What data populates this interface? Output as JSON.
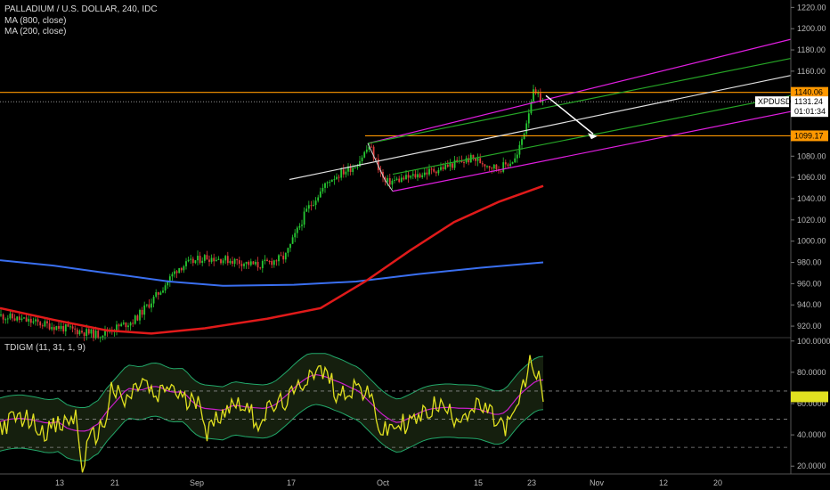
{
  "header": {
    "title": "PALLADIUM / U.S. DOLLAR, 240, IDC",
    "ma1": "MA (800, close)",
    "ma2": "MA (200, close)"
  },
  "indicator": {
    "label": "TDIGM (11, 31, 1, 9)"
  },
  "price_tags": {
    "upper_level": "1140.06",
    "current": "1131.24",
    "symbol": "XPDUSD",
    "countdown": "01:01:34",
    "lower_level": "1099.17"
  },
  "colors": {
    "background": "#000000",
    "candle_up": "#26c832",
    "candle_down": "#e03b3b",
    "ma800": "#3a6ff0",
    "ma200": "#e01a1a",
    "level_line": "#ff9800",
    "channel_outer": "#e01ee0",
    "channel_inner": "#26a626",
    "median_line": "#e0e0e0",
    "rsi": "#e0e020",
    "rsi_signal": "#c81ec8",
    "band": "#22a86a"
  },
  "chart_data": [
    {
      "type": "line",
      "title": "PALLADIUM / U.S. DOLLAR, 240, IDC",
      "x_ticks": [
        "13",
        "21",
        "Sep",
        "17",
        "Oct",
        "15",
        "23",
        "Nov",
        "12",
        "20"
      ],
      "y_ticks": [
        920,
        940,
        960,
        980,
        1000,
        1020,
        1040,
        1060,
        1080,
        1100,
        1120,
        1140,
        1160,
        1180,
        1200,
        1220
      ],
      "ylim": [
        910,
        1227
      ],
      "grid": false,
      "series": [
        {
          "name": "MA (800, close)",
          "points": [
            [
              0,
              982
            ],
            [
              60,
              977
            ],
            [
              120,
              970
            ],
            [
              190,
              962
            ],
            [
              250,
              958
            ],
            [
              330,
              959
            ],
            [
              400,
              962
            ],
            [
              470,
              969
            ],
            [
              540,
              975
            ],
            [
              610,
              980
            ]
          ]
        },
        {
          "name": "MA (200, close)",
          "points": [
            [
              0,
              937
            ],
            [
              60,
              926
            ],
            [
              120,
              916
            ],
            [
              170,
              913
            ],
            [
              230,
              918
            ],
            [
              300,
              927
            ],
            [
              360,
              937
            ],
            [
              410,
              962
            ],
            [
              460,
              991
            ],
            [
              510,
              1018
            ],
            [
              560,
              1037
            ],
            [
              610,
              1052
            ]
          ]
        }
      ],
      "price_path": [
        [
          0,
          930
        ],
        [
          60,
          920
        ],
        [
          110,
          912
        ],
        [
          150,
          925
        ],
        [
          175,
          948
        ],
        [
          200,
          975
        ],
        [
          230,
          985
        ],
        [
          260,
          982
        ],
        [
          290,
          977
        ],
        [
          320,
          985
        ],
        [
          345,
          1030
        ],
        [
          370,
          1058
        ],
        [
          400,
          1072
        ],
        [
          415,
          1090
        ],
        [
          432,
          1055
        ],
        [
          460,
          1060
        ],
        [
          500,
          1070
        ],
        [
          530,
          1078
        ],
        [
          560,
          1068
        ],
        [
          580,
          1078
        ],
        [
          590,
          1108
        ],
        [
          598,
          1140
        ],
        [
          610,
          1131
        ]
      ],
      "levels": [
        1140.06,
        1099.17
      ],
      "last_price": 1131.24
    },
    {
      "type": "line",
      "title": "TDIGM (11, 31, 1, 9)",
      "y_ticks": [
        20,
        40,
        60,
        80,
        100
      ],
      "ylim": [
        15,
        101
      ],
      "dashed_levels": [
        32,
        50,
        68
      ],
      "series": [
        {
          "name": "TDIGM",
          "points": [
            [
              0,
              45
            ],
            [
              25,
              52
            ],
            [
              50,
              43
            ],
            [
              70,
              46
            ],
            [
              85,
              52
            ],
            [
              92,
              18
            ],
            [
              100,
              35
            ],
            [
              118,
              48
            ],
            [
              125,
              70
            ],
            [
              140,
              60
            ],
            [
              160,
              75
            ],
            [
              175,
              62
            ],
            [
              190,
              72
            ],
            [
              210,
              60
            ],
            [
              225,
              65
            ],
            [
              232,
              40
            ],
            [
              250,
              56
            ],
            [
              270,
              62
            ],
            [
              290,
              48
            ],
            [
              300,
              55
            ],
            [
              330,
              65
            ],
            [
              350,
              82
            ],
            [
              368,
              78
            ],
            [
              380,
              65
            ],
            [
              400,
              72
            ],
            [
              420,
              60
            ],
            [
              428,
              40
            ],
            [
              440,
              45
            ],
            [
              470,
              50
            ],
            [
              490,
              60
            ],
            [
              510,
              52
            ],
            [
              540,
              58
            ],
            [
              565,
              45
            ],
            [
              575,
              48
            ],
            [
              585,
              65
            ],
            [
              595,
              85
            ],
            [
              603,
              80
            ],
            [
              610,
              68
            ]
          ]
        }
      ],
      "last_value": 64.29
    }
  ]
}
